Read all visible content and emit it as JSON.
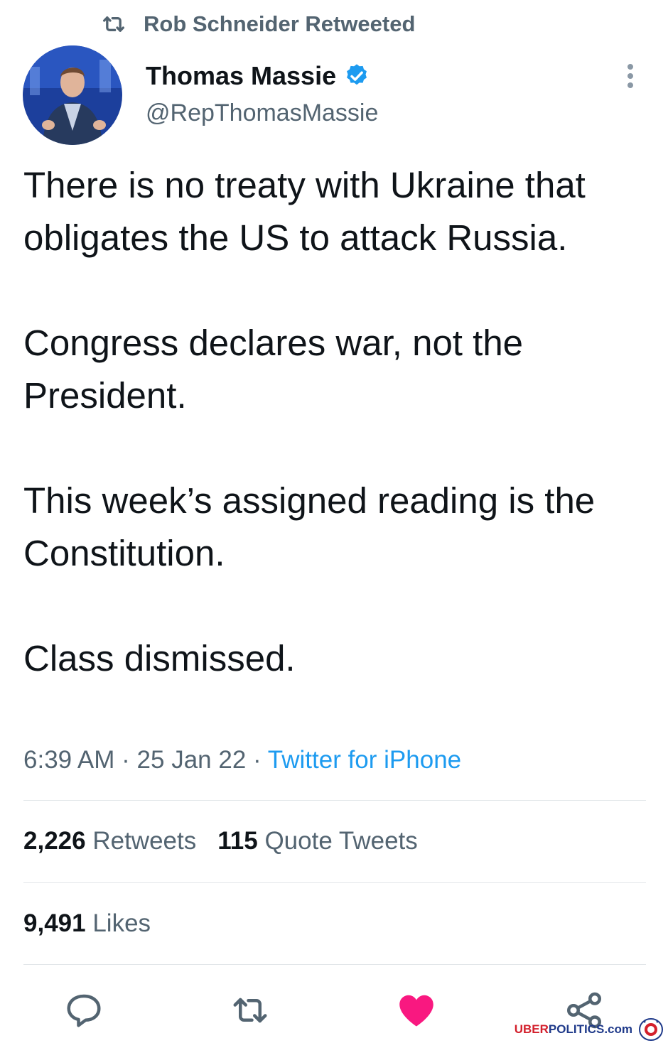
{
  "retweet_banner": {
    "text": "Rob Schneider Retweeted",
    "icon": "retweet-icon"
  },
  "author": {
    "display_name": "Thomas Massie",
    "handle": "@RepThomasMassie",
    "verified": true,
    "avatar": "avatar-photo"
  },
  "tweet": {
    "paragraphs": [
      "There is no treaty with Ukraine that obligates the US to attack Russia.",
      "Congress declares war, not the President.",
      "This week’s assigned reading is the Constitution.",
      "Class dismissed."
    ],
    "time": "6:39 AM",
    "date": "25 Jan 22",
    "separator": "·",
    "source": "Twitter for iPhone"
  },
  "stats": {
    "retweets_count": "2,226",
    "retweets_label": "Retweets",
    "quotes_count": "115",
    "quotes_label": "Quote Tweets",
    "likes_count": "9,491",
    "likes_label": "Likes"
  },
  "actions": {
    "reply": "reply-icon",
    "retweet": "retweet-icon",
    "like": "heart-icon",
    "share": "share-icon",
    "liked": true
  },
  "watermark": {
    "part1": "UBER",
    "part2": "POLITICS",
    "part3": ".com"
  },
  "colors": {
    "text": "#0f1419",
    "secondary": "#536471",
    "link": "#1d9bf0",
    "like": "#f91880",
    "verified": "#1d9bf0",
    "divider": "#e2e6e9"
  }
}
